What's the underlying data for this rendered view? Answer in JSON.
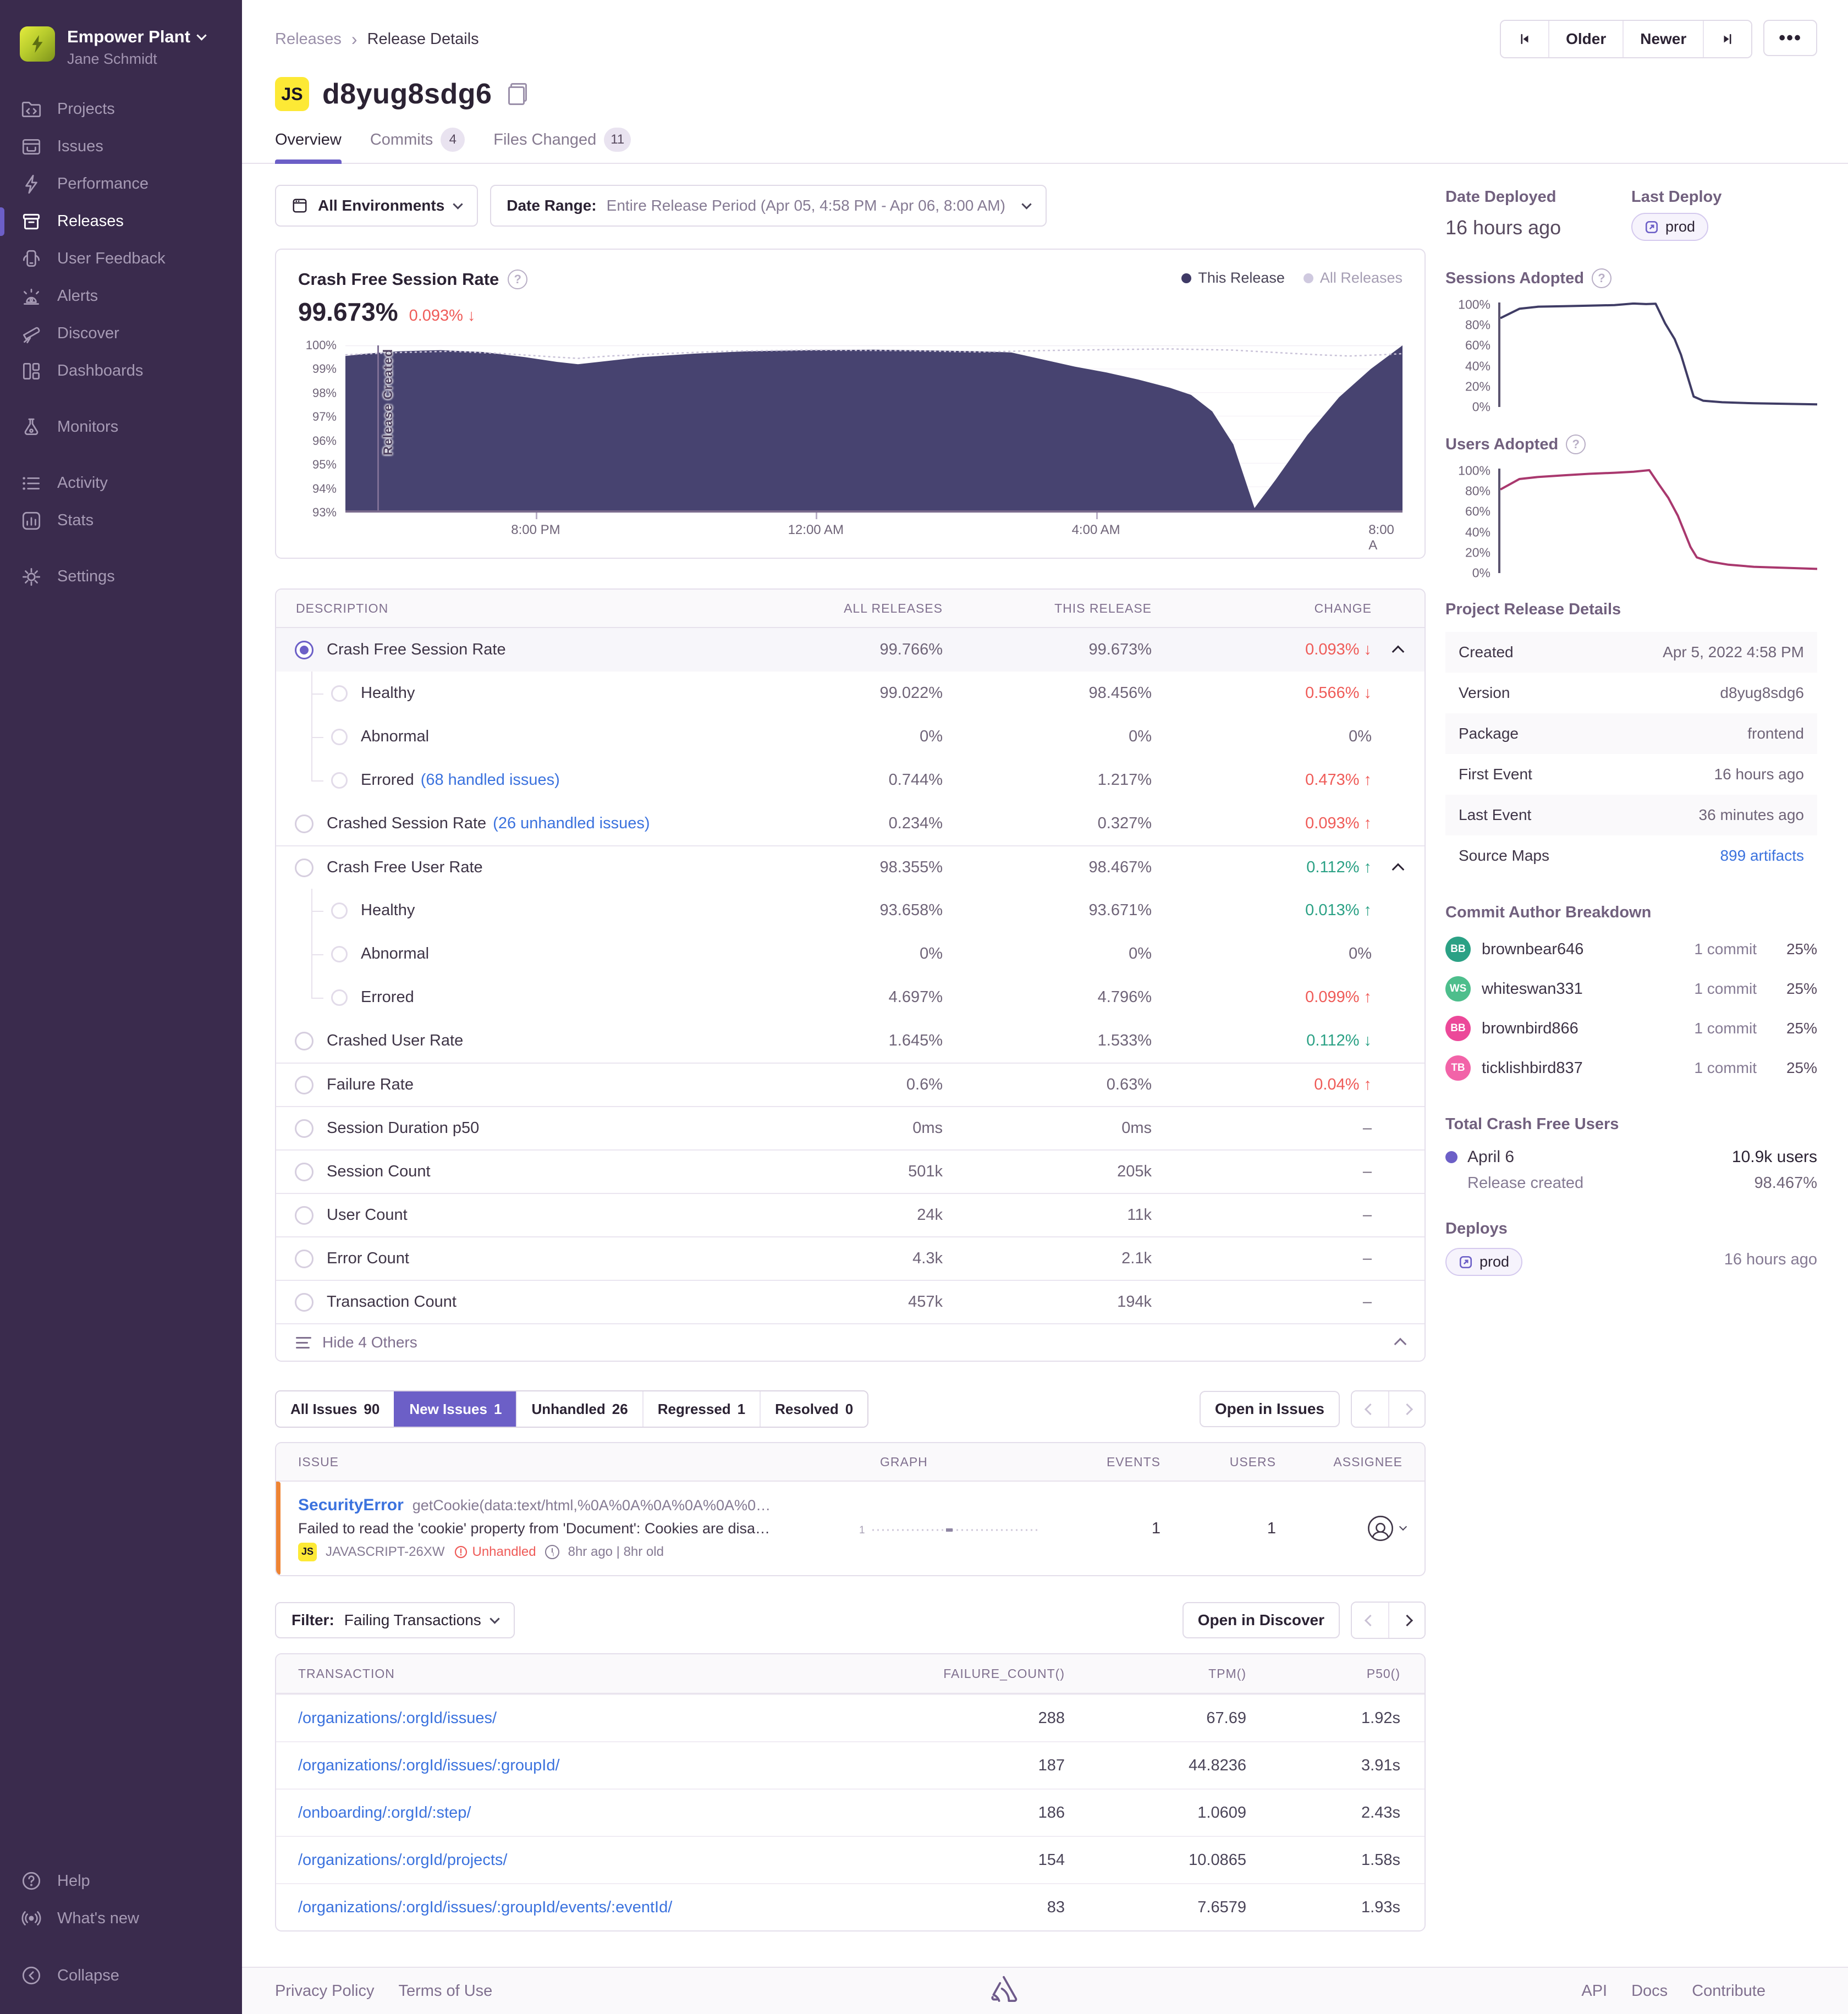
{
  "colors": {
    "accent": "#6C5FC7",
    "red": "#EF5B58",
    "green": "#2BA185",
    "link": "#3B72DE",
    "chart_navy": "#474370",
    "chart_magenta": "#A9386E",
    "badge_yellow": "#FDE935",
    "issue_orange": "#EE8434"
  },
  "sidebar": {
    "org": "Empower Plant",
    "user": "Jane Schmidt",
    "items": [
      {
        "label": "Projects"
      },
      {
        "label": "Issues"
      },
      {
        "label": "Performance"
      },
      {
        "label": "Releases"
      },
      {
        "label": "User Feedback"
      },
      {
        "label": "Alerts"
      },
      {
        "label": "Discover"
      },
      {
        "label": "Dashboards"
      },
      {
        "label": "Monitors"
      },
      {
        "label": "Activity"
      },
      {
        "label": "Stats"
      },
      {
        "label": "Settings"
      }
    ],
    "footer": [
      {
        "label": "Help"
      },
      {
        "label": "What's new"
      },
      {
        "label": "Collapse"
      }
    ]
  },
  "topbar": {
    "breadcrumb": [
      "Releases",
      "Release Details"
    ],
    "older": "Older",
    "newer": "Newer"
  },
  "release": {
    "badge": "JS",
    "title": "d8yug8sdg6"
  },
  "tabs": [
    {
      "label": "Overview"
    },
    {
      "label": "Commits",
      "count": "4"
    },
    {
      "label": "Files Changed",
      "count": "11"
    }
  ],
  "filters": {
    "environments": "All Environments",
    "date_label": "Date Range:",
    "date_value": "Entire Release Period (Apr 05, 4:58 PM - Apr 06, 8:00 AM)"
  },
  "chart": {
    "title": "Crash Free Session Rate",
    "legend_this": "This Release",
    "legend_all": "All Releases",
    "value": "99.673%",
    "delta": "0.093%",
    "delta_dir": "↓",
    "marker": "Release Created",
    "y_labels": [
      "100%",
      "99%",
      "98%",
      "97%",
      "96%",
      "95%",
      "94%",
      "93%"
    ],
    "x_labels": [
      "8:00 PM",
      "12:00 AM",
      "4:00 AM",
      "8:00 A"
    ]
  },
  "charts": {
    "main": {
      "type": "area",
      "ymin": 93,
      "ymax": 100,
      "this_release": [
        [
          0,
          99.55
        ],
        [
          2,
          99.65
        ],
        [
          5,
          99.75
        ],
        [
          9,
          99.8
        ],
        [
          13,
          99.72
        ],
        [
          17,
          99.5
        ],
        [
          20,
          99.3
        ],
        [
          22,
          99.2
        ],
        [
          24,
          99.3
        ],
        [
          28,
          99.5
        ],
        [
          33,
          99.65
        ],
        [
          38,
          99.75
        ],
        [
          44,
          99.8
        ],
        [
          50,
          99.82
        ],
        [
          56,
          99.78
        ],
        [
          60,
          99.75
        ],
        [
          63,
          99.7
        ],
        [
          66,
          99.4
        ],
        [
          69,
          99.1
        ],
        [
          72,
          98.85
        ],
        [
          75,
          98.55
        ],
        [
          78,
          98.2
        ],
        [
          80,
          97.9
        ],
        [
          82,
          97.2
        ],
        [
          84,
          95.8
        ],
        [
          86,
          93.1
        ],
        [
          88,
          94.3
        ],
        [
          91,
          96.2
        ],
        [
          94,
          97.8
        ],
        [
          97,
          99.0
        ],
        [
          100,
          100
        ]
      ],
      "all_releases": [
        [
          0,
          99.6
        ],
        [
          5,
          99.7
        ],
        [
          10,
          99.75
        ],
        [
          15,
          99.65
        ],
        [
          20,
          99.5
        ],
        [
          22,
          99.45
        ],
        [
          25,
          99.55
        ],
        [
          30,
          99.65
        ],
        [
          36,
          99.75
        ],
        [
          44,
          99.8
        ],
        [
          52,
          99.78
        ],
        [
          60,
          99.72
        ],
        [
          66,
          99.78
        ],
        [
          72,
          99.82
        ],
        [
          78,
          99.85
        ],
        [
          84,
          99.8
        ],
        [
          88,
          99.7
        ],
        [
          92,
          99.6
        ],
        [
          95,
          99.55
        ],
        [
          98,
          99.6
        ],
        [
          100,
          99.65
        ]
      ]
    },
    "sessions": {
      "type": "line",
      "ymin": 0,
      "ymax": 100,
      "values": [
        [
          0,
          85
        ],
        [
          6,
          94
        ],
        [
          12,
          96
        ],
        [
          20,
          96.5
        ],
        [
          28,
          97
        ],
        [
          36,
          97.5
        ],
        [
          42,
          99
        ],
        [
          46,
          98.5
        ],
        [
          49,
          98.8
        ],
        [
          52,
          80
        ],
        [
          55,
          65
        ],
        [
          57,
          50
        ],
        [
          59,
          30
        ],
        [
          61,
          10
        ],
        [
          64,
          6
        ],
        [
          70,
          4.5
        ],
        [
          80,
          3.5
        ],
        [
          90,
          3
        ],
        [
          100,
          2.5
        ]
      ]
    },
    "users": {
      "type": "line",
      "ymin": 0,
      "ymax": 100,
      "values": [
        [
          0,
          80
        ],
        [
          6,
          90
        ],
        [
          12,
          92
        ],
        [
          20,
          93.5
        ],
        [
          28,
          95
        ],
        [
          36,
          96
        ],
        [
          42,
          97
        ],
        [
          47,
          98.5
        ],
        [
          50,
          85
        ],
        [
          53,
          72
        ],
        [
          56,
          55
        ],
        [
          58,
          40
        ],
        [
          60,
          25
        ],
        [
          62,
          15
        ],
        [
          66,
          11
        ],
        [
          72,
          8
        ],
        [
          80,
          6
        ],
        [
          90,
          5
        ],
        [
          100,
          4
        ]
      ]
    }
  },
  "metrics": {
    "columns": [
      "DESCRIPTION",
      "ALL RELEASES",
      "THIS RELEASE",
      "CHANGE"
    ],
    "rows": [
      {
        "label": "Crash Free Session Rate",
        "all": "99.766%",
        "this": "99.673%",
        "change": "0.093%",
        "dir": "↓"
      },
      {
        "label": "Healthy",
        "all": "99.022%",
        "this": "98.456%",
        "change": "0.566%",
        "dir": "↓"
      },
      {
        "label": "Abnormal",
        "all": "0%",
        "this": "0%",
        "change": "0%",
        "dir": ""
      },
      {
        "label": "Errored",
        "link": "(68 handled issues)",
        "all": "0.744%",
        "this": "1.217%",
        "change": "0.473%",
        "dir": "↑"
      },
      {
        "label": "Crashed Session Rate",
        "link": "(26 unhandled issues)",
        "all": "0.234%",
        "this": "0.327%",
        "change": "0.093%",
        "dir": "↑"
      },
      {
        "label": "Crash Free User Rate",
        "all": "98.355%",
        "this": "98.467%",
        "change": "0.112%",
        "dir": "↑"
      },
      {
        "label": "Healthy",
        "all": "93.658%",
        "this": "93.671%",
        "change": "0.013%",
        "dir": "↑"
      },
      {
        "label": "Abnormal",
        "all": "0%",
        "this": "0%",
        "change": "0%",
        "dir": ""
      },
      {
        "label": "Errored",
        "all": "4.697%",
        "this": "4.796%",
        "change": "0.099%",
        "dir": "↑"
      },
      {
        "label": "Crashed User Rate",
        "all": "1.645%",
        "this": "1.533%",
        "change": "0.112%",
        "dir": "↓"
      },
      {
        "label": "Failure Rate",
        "all": "0.6%",
        "this": "0.63%",
        "change": "0.04%",
        "dir": "↑"
      },
      {
        "label": "Session Duration p50",
        "all": "0ms",
        "this": "0ms",
        "change": "–",
        "dir": ""
      },
      {
        "label": "Session Count",
        "all": "501k",
        "this": "205k",
        "change": "–",
        "dir": ""
      },
      {
        "label": "User Count",
        "all": "24k",
        "this": "11k",
        "change": "–",
        "dir": ""
      },
      {
        "label": "Error Count",
        "all": "4.3k",
        "this": "2.1k",
        "change": "–",
        "dir": ""
      },
      {
        "label": "Transaction Count",
        "all": "457k",
        "this": "194k",
        "change": "–",
        "dir": ""
      }
    ],
    "footer": "Hide 4 Others"
  },
  "issues": {
    "tabs": [
      {
        "label": "All Issues",
        "count": "90"
      },
      {
        "label": "New Issues",
        "count": "1"
      },
      {
        "label": "Unhandled",
        "count": "26"
      },
      {
        "label": "Regressed",
        "count": "1"
      },
      {
        "label": "Resolved",
        "count": "0"
      }
    ],
    "open": "Open in Issues",
    "columns": [
      "ISSUE",
      "GRAPH",
      "EVENTS",
      "USERS",
      "ASSIGNEE"
    ],
    "row": {
      "title": "SecurityError",
      "culprit": "getCookie(data:text/html,%0A%0A%0A%0A%0A%0…",
      "message": "Failed to read the 'cookie' property from 'Document': Cookies are disa…",
      "project_badge": "JS",
      "project": "JAVASCRIPT-26XW",
      "unhandled": "Unhandled",
      "age": "8hr ago | 8hr old",
      "spark_label": "1",
      "events": "1",
      "users": "1"
    }
  },
  "transactions": {
    "filter_label": "Filter:",
    "filter_value": "Failing Transactions",
    "open": "Open in Discover",
    "columns": [
      "TRANSACTION",
      "FAILURE_COUNT()",
      "TPM()",
      "P50()"
    ],
    "rows": [
      {
        "path": "/organizations/:orgId/issues/",
        "failures": "288",
        "tpm": "67.69",
        "p50": "1.92s"
      },
      {
        "path": "/organizations/:orgId/issues/:groupId/",
        "failures": "187",
        "tpm": "44.8236",
        "p50": "3.91s"
      },
      {
        "path": "/onboarding/:orgId/:step/",
        "failures": "186",
        "tpm": "1.0609",
        "p50": "2.43s"
      },
      {
        "path": "/organizations/:orgId/projects/",
        "failures": "154",
        "tpm": "10.0865",
        "p50": "1.58s"
      },
      {
        "path": "/organizations/:orgId/issues/:groupId/events/:eventId/",
        "failures": "83",
        "tpm": "7.6579",
        "p50": "1.93s"
      }
    ]
  },
  "aside": {
    "date_deployed_label": "Date Deployed",
    "date_deployed": "16 hours ago",
    "last_deploy_label": "Last Deploy",
    "deploy_env": "prod",
    "sessions_title": "Sessions Adopted",
    "users_title": "Users Adopted",
    "axis": [
      "100%",
      "80%",
      "60%",
      "40%",
      "20%",
      "0%"
    ],
    "details_title": "Project Release Details",
    "details": [
      {
        "label": "Created",
        "value": "Apr 5, 2022 4:58 PM"
      },
      {
        "label": "Version",
        "value": "d8yug8sdg6"
      },
      {
        "label": "Package",
        "value": "frontend"
      },
      {
        "label": "First Event",
        "value": "16 hours ago"
      },
      {
        "label": "Last Event",
        "value": "36 minutes ago"
      },
      {
        "label": "Source Maps",
        "value": "899 artifacts"
      }
    ],
    "commits_title": "Commit Author Breakdown",
    "authors": [
      {
        "initials": "BB",
        "name": "brownbear646",
        "commits": "1 commit",
        "pct": "25%"
      },
      {
        "initials": "WS",
        "name": "whiteswan331",
        "commits": "1 commit",
        "pct": "25%"
      },
      {
        "initials": "BB",
        "name": "brownbird866",
        "commits": "1 commit",
        "pct": "25%"
      },
      {
        "initials": "TB",
        "name": "ticklishbird837",
        "commits": "1 commit",
        "pct": "25%"
      }
    ],
    "tcfu_title": "Total Crash Free Users",
    "tcfu_date": "April 6",
    "tcfu_users": "10.9k users",
    "tcfu_sub": "Release created",
    "tcfu_pct": "98.467%",
    "deploys_title": "Deploys",
    "deploys_time": "16 hours ago"
  },
  "footer": {
    "links_left": [
      "Privacy Policy",
      "Terms of Use"
    ],
    "links_right": [
      "API",
      "Docs",
      "Contribute"
    ]
  }
}
